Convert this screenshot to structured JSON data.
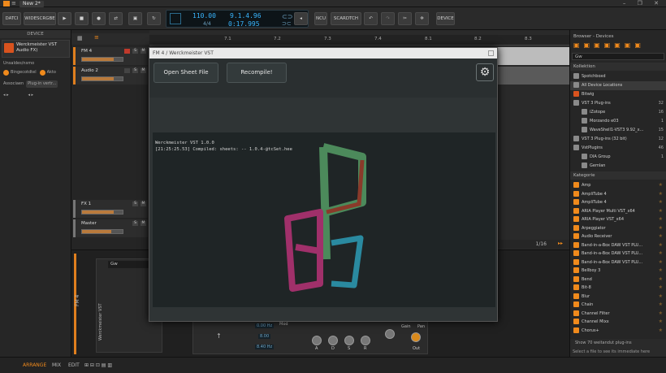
{
  "titlebar": {
    "doc_tab": "New 2*",
    "window_controls": "– ❐ ✕"
  },
  "toolbar": {
    "dataset_btn": "DATCI",
    "wide_btn": "WIDESCRGBE",
    "ncu_btn": "NCU",
    "scratch_btn": "SCARDTCH",
    "device_btn": "DEVICE",
    "tempo": "110.00",
    "signature": "4/4",
    "position": "9.1.4.96",
    "time": "0:17.995",
    "colors": {
      "lcd": "#39b6ff",
      "accent": "#f08a1c"
    }
  },
  "left": {
    "header": "DEVICE",
    "device_name": "Werckmeister VST Audio FX)",
    "line1": "Unsaldes/nsmo",
    "line2_a": "Bingecotdtel",
    "line2_b": "Akto",
    "assoc_label": "Associaen",
    "assoc_value": "Plug-in vertr..."
  },
  "tracks": [
    {
      "name": "FM 4",
      "fill": 0.78
    },
    {
      "name": "Audio 2",
      "fill": 0.78
    },
    {
      "name": "FX 1",
      "fill": 0.78
    },
    {
      "name": "Master",
      "fill": 0.72
    }
  ],
  "ruler": [
    "7.1",
    "7.2",
    "7.3",
    "7.4",
    "8.1",
    "8.2",
    "8.3"
  ],
  "arranger": {
    "zoom": "1/16"
  },
  "bottom": {
    "vertical_label": "Werckmeister VST",
    "track_label": "FM 4",
    "chain_item": "Gw",
    "synth_vals": [
      "0.00 Hz",
      "8.00",
      "8.40 Hz"
    ],
    "knob_labels": [
      "A",
      "D",
      "S",
      "R",
      "Gain",
      "Pan",
      "Out"
    ],
    "mod_label": "Mod"
  },
  "plugin": {
    "title": "FM 4 / Werckmeister VST",
    "open_btn": "Open Sheet File",
    "recompile_btn": "Recompile!",
    "console_line1": "Werckmeister VST 1.0.0",
    "console_line2": "[21:25:25.53] Compiled: sheets: -- 1.0.4-@tcSet.hee"
  },
  "right": {
    "header": "Browser - Devices",
    "search_placeholder": "Gw",
    "section_collection": "Kollektion",
    "collection": [
      {
        "label": "Spotchboxd",
        "count": ""
      },
      {
        "label": "All Device Locations",
        "count": "",
        "selected": true
      },
      {
        "label": "Bitwig",
        "count": ""
      },
      {
        "label": "VST 3 Plug-ins",
        "count": "32"
      },
      {
        "label": "iZotope",
        "count": "16"
      },
      {
        "label": "Morzando e03",
        "count": "1"
      },
      {
        "label": "WaveShell1-VST3 9.92_x...",
        "count": "15"
      },
      {
        "label": "VST 3 Plug-ins (32 bit)",
        "count": "12"
      },
      {
        "label": "VstPlugins",
        "count": "46"
      },
      {
        "label": "DIA Group",
        "count": "1"
      },
      {
        "label": "Gemlan",
        "count": ""
      }
    ],
    "section_category": "Kategorie",
    "categories": [
      "Amp",
      "AmpliTube 4",
      "AmpliTube 4",
      "ARIA Player Multi VST_x64",
      "ARIA Player VST_x64",
      "Arpeggiator",
      "Audio Receiver",
      "Band-in-a-Box DAW VST PLU...",
      "Band-in-a-Box DAW VST PLU...",
      "Band-in-a-Box DAW VST PLU...",
      "Bellboy 3",
      "Bend",
      "Bit-8",
      "Blur",
      "Chain",
      "Channel Filter",
      "Channel Mixx",
      "Chorus+"
    ],
    "footer1": "Show 70 weitandut plug-ins",
    "footer2": "Select a file to see its immediate here"
  },
  "status": {
    "arrange": "ARRANGE",
    "mix": "MIX",
    "edit": "EDIT"
  }
}
